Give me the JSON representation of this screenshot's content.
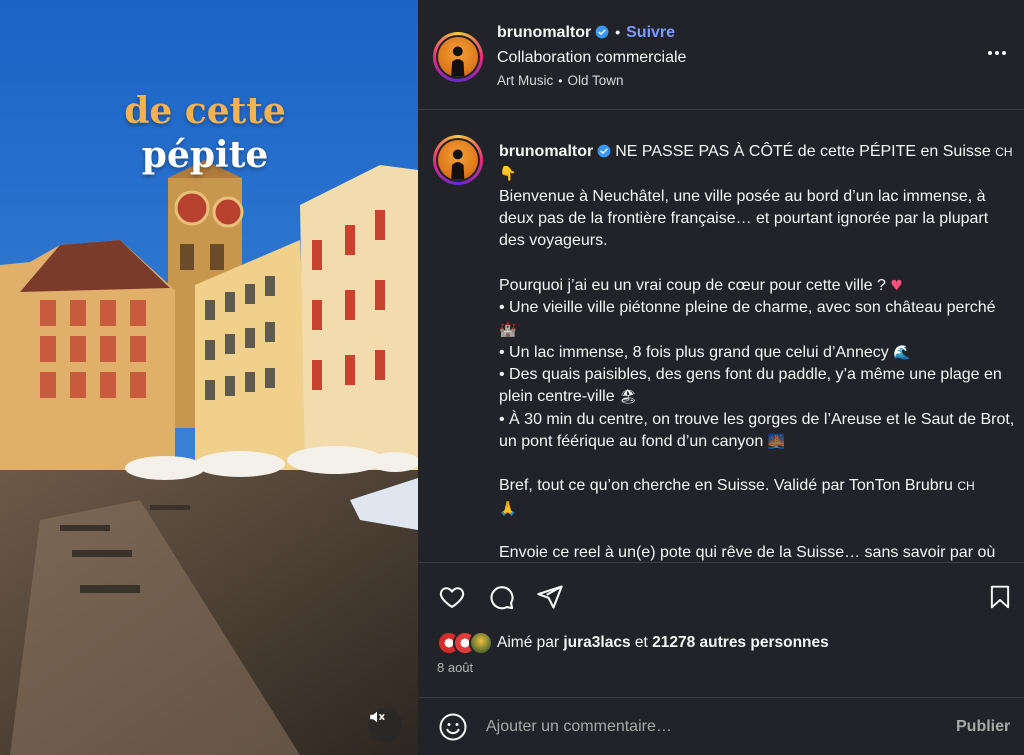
{
  "media": {
    "overlay_line1": "de cette",
    "overlay_line2": "pépite",
    "mute_icon": "speaker-muted-icon"
  },
  "header": {
    "username": "brunomaltor",
    "separator": "•",
    "follow_label": "Suivre",
    "collab_label": "Collaboration commerciale",
    "music_label": "Art Music",
    "location_label": "Old Town"
  },
  "caption": {
    "username": "brunomaltor",
    "line_first": "NE PASSE PAS À CÔTÉ de cette PÉPITE en Suisse",
    "flag_ch": "CH",
    "lines": [
      "Bienvenue à Neuchâtel, une ville posée au bord d’un lac immense, à deux pas de la frontière française… et pourtant ignorée par la plupart des voyageurs.",
      "Pourquoi j’ai eu un vrai coup de cœur pour cette ville ?",
      "• Une vieille ville piétonne pleine de charme, avec son château perché",
      "• Un lac immense, 8 fois plus grand que celui d’Annecy",
      "• Des quais paisibles, des gens font du paddle, y’a même une plage en plein centre-ville",
      "• À 30 min du centre, on trouve les gorges de l’Areuse et le Saut de Brot, un pont féérique au fond d’un canyon",
      "Bref, tout ce qu’on cherche en Suisse. Validé par TonTon Brubru",
      "Envoie ce reel à un(e) pote qui rêve de la Suisse… sans savoir par où"
    ]
  },
  "likes": {
    "prefix": "Aimé par",
    "user": "jura3lacs",
    "connector": "et",
    "others": "21278 autres personnes"
  },
  "date": "8 août",
  "comment": {
    "placeholder": "Ajouter un commentaire…",
    "publish_label": "Publier"
  },
  "colors": {
    "panel_bg": "#212328",
    "follow_blue": "#7a9cff",
    "verified_blue": "#3897f0"
  }
}
